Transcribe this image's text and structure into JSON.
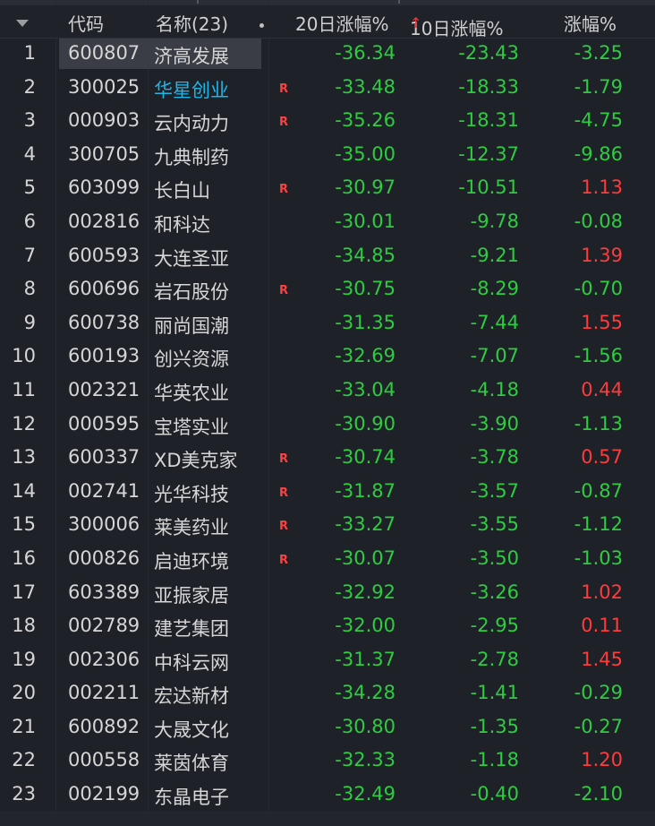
{
  "header": {
    "col_code": "代码",
    "col_name": "名称(23)",
    "col_20d": "20日涨幅%",
    "col_10d": "10日涨幅%",
    "col_10d_sort": "↑",
    "col_chg": "涨幅%"
  },
  "colors": {
    "up": "#ff3b3b",
    "down": "#2ecc40",
    "highlight_name": "#1fb6e6",
    "background": "#1e2128"
  },
  "rows": [
    {
      "idx": "1",
      "code": "600807",
      "name": "济高发展",
      "r": "",
      "d20": "-36.34",
      "d10": "-23.43",
      "chg": "-3.25",
      "chg_dir": "down",
      "selected": true
    },
    {
      "idx": "2",
      "code": "300025",
      "name": "华星创业",
      "r": "R",
      "d20": "-33.48",
      "d10": "-18.33",
      "chg": "-1.79",
      "chg_dir": "down",
      "blue": true
    },
    {
      "idx": "3",
      "code": "000903",
      "name": "云内动力",
      "r": "R",
      "d20": "-35.26",
      "d10": "-18.31",
      "chg": "-4.75",
      "chg_dir": "down"
    },
    {
      "idx": "4",
      "code": "300705",
      "name": "九典制药",
      "r": "",
      "d20": "-35.00",
      "d10": "-12.37",
      "chg": "-9.86",
      "chg_dir": "down"
    },
    {
      "idx": "5",
      "code": "603099",
      "name": "长白山",
      "r": "R",
      "d20": "-30.97",
      "d10": "-10.51",
      "chg": "1.13",
      "chg_dir": "up"
    },
    {
      "idx": "6",
      "code": "002816",
      "name": "和科达",
      "r": "",
      "d20": "-30.01",
      "d10": "-9.78",
      "chg": "-0.08",
      "chg_dir": "down"
    },
    {
      "idx": "7",
      "code": "600593",
      "name": "大连圣亚",
      "r": "",
      "d20": "-34.85",
      "d10": "-9.21",
      "chg": "1.39",
      "chg_dir": "up"
    },
    {
      "idx": "8",
      "code": "600696",
      "name": "岩石股份",
      "r": "R",
      "d20": "-30.75",
      "d10": "-8.29",
      "chg": "-0.70",
      "chg_dir": "down"
    },
    {
      "idx": "9",
      "code": "600738",
      "name": "丽尚国潮",
      "r": "",
      "d20": "-31.35",
      "d10": "-7.44",
      "chg": "1.55",
      "chg_dir": "up"
    },
    {
      "idx": "10",
      "code": "600193",
      "name": "创兴资源",
      "r": "",
      "d20": "-32.69",
      "d10": "-7.07",
      "chg": "-1.56",
      "chg_dir": "down"
    },
    {
      "idx": "11",
      "code": "002321",
      "name": "华英农业",
      "r": "",
      "d20": "-33.04",
      "d10": "-4.18",
      "chg": "0.44",
      "chg_dir": "up"
    },
    {
      "idx": "12",
      "code": "000595",
      "name": "宝塔实业",
      "r": "",
      "d20": "-30.90",
      "d10": "-3.90",
      "chg": "-1.13",
      "chg_dir": "down"
    },
    {
      "idx": "13",
      "code": "600337",
      "name": "XD美克家",
      "r": "R",
      "d20": "-30.74",
      "d10": "-3.78",
      "chg": "0.57",
      "chg_dir": "up"
    },
    {
      "idx": "14",
      "code": "002741",
      "name": "光华科技",
      "r": "R",
      "d20": "-31.87",
      "d10": "-3.57",
      "chg": "-0.87",
      "chg_dir": "down"
    },
    {
      "idx": "15",
      "code": "300006",
      "name": "莱美药业",
      "r": "R",
      "d20": "-33.27",
      "d10": "-3.55",
      "chg": "-1.12",
      "chg_dir": "down"
    },
    {
      "idx": "16",
      "code": "000826",
      "name": "启迪环境",
      "r": "R",
      "d20": "-30.07",
      "d10": "-3.50",
      "chg": "-1.03",
      "chg_dir": "down"
    },
    {
      "idx": "17",
      "code": "603389",
      "name": "亚振家居",
      "r": "",
      "d20": "-32.92",
      "d10": "-3.26",
      "chg": "1.02",
      "chg_dir": "up"
    },
    {
      "idx": "18",
      "code": "002789",
      "name": "建艺集团",
      "r": "",
      "d20": "-32.00",
      "d10": "-2.95",
      "chg": "0.11",
      "chg_dir": "up"
    },
    {
      "idx": "19",
      "code": "002306",
      "name": "中科云网",
      "r": "",
      "d20": "-31.37",
      "d10": "-2.78",
      "chg": "1.45",
      "chg_dir": "up"
    },
    {
      "idx": "20",
      "code": "002211",
      "name": "宏达新材",
      "r": "",
      "d20": "-34.28",
      "d10": "-1.41",
      "chg": "-0.29",
      "chg_dir": "down"
    },
    {
      "idx": "21",
      "code": "600892",
      "name": "大晟文化",
      "r": "",
      "d20": "-30.80",
      "d10": "-1.35",
      "chg": "-0.27",
      "chg_dir": "down"
    },
    {
      "idx": "22",
      "code": "000558",
      "name": "莱茵体育",
      "r": "",
      "d20": "-32.33",
      "d10": "-1.18",
      "chg": "1.20",
      "chg_dir": "up"
    },
    {
      "idx": "23",
      "code": "002199",
      "name": "东晶电子",
      "r": "",
      "d20": "-32.49",
      "d10": "-0.40",
      "chg": "-2.10",
      "chg_dir": "down"
    }
  ]
}
